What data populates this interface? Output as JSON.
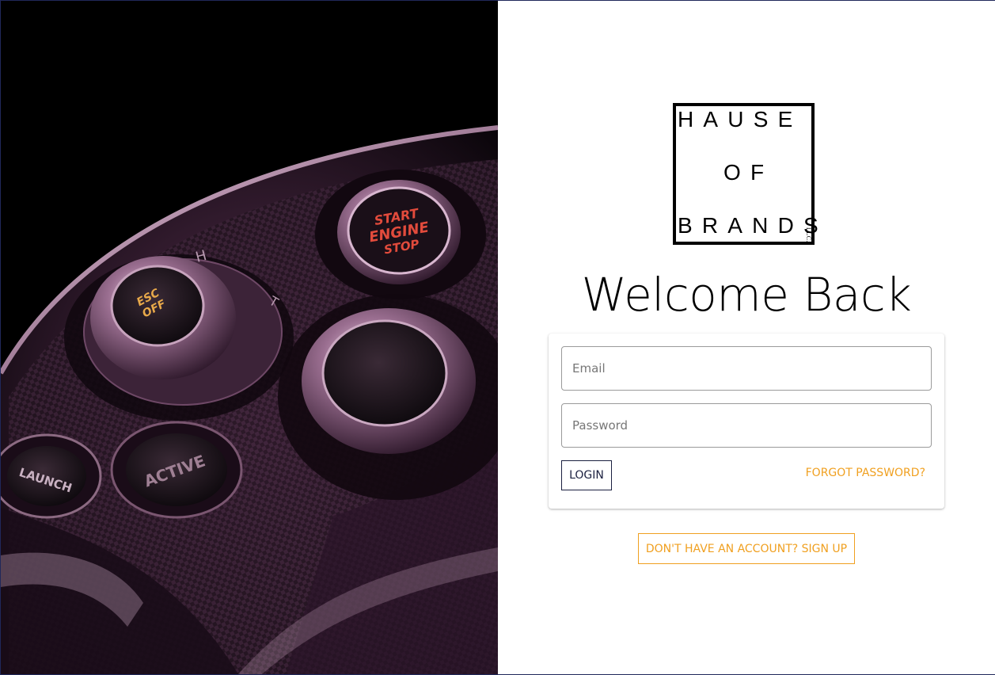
{
  "hero": {
    "button_start_engine": [
      "START",
      "ENGINE",
      "STOP"
    ],
    "button_esc_off": [
      "ESC",
      "OFF"
    ],
    "button_launch": "LAUNCH",
    "button_active": "ACTIVE",
    "dial_letters": [
      "H",
      "T"
    ]
  },
  "logo": {
    "row1": "HAUSE",
    "row2": "OF",
    "row3": "BRANDS",
    "suffix": "LLC."
  },
  "page": {
    "title": "Welcome Back"
  },
  "form": {
    "email_placeholder": "Email",
    "password_placeholder": "Password",
    "login_label": "LOGIN",
    "forgot_label": "FORGOT PASSWORD?",
    "signup_label": "DON'T HAVE AN ACCOUNT? SIGN UP"
  },
  "colors": {
    "accent": "#f0a020",
    "primary": "#1b2040",
    "field_border": "#9a9a9a"
  }
}
